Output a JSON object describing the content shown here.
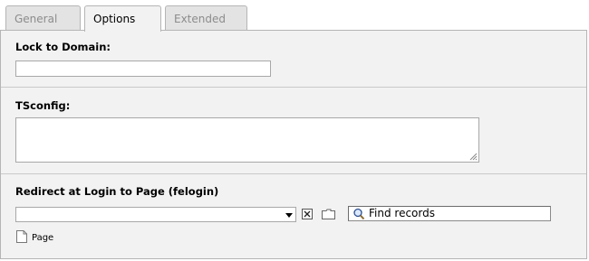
{
  "tabs": [
    {
      "label": "General"
    },
    {
      "label": "Options"
    },
    {
      "label": "Extended"
    }
  ],
  "active_tab": "Options",
  "fields": {
    "lock_to_domain": {
      "label": "Lock to Domain:",
      "value": ""
    },
    "tsconfig": {
      "label": "TSconfig:",
      "value": ""
    },
    "redirect": {
      "label": "Redirect at Login to Page (felogin)",
      "selected": "",
      "search_placeholder": "Find records",
      "allowed_table": "Page"
    }
  },
  "icons": {
    "clear": "close-icon",
    "browse": "folder-icon",
    "search": "magnifier-icon",
    "page": "page-icon"
  },
  "colors": {
    "panel_bg": "#f2f2f2",
    "tab_inactive_bg": "#e3e3e3",
    "border": "#b5b5b5"
  }
}
